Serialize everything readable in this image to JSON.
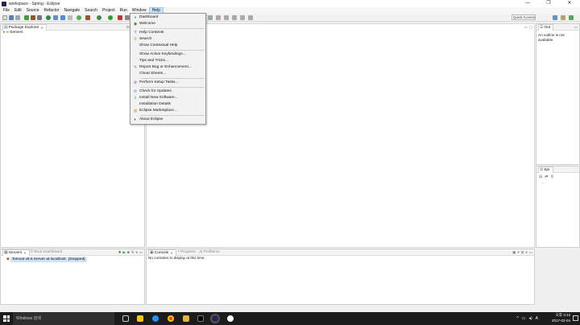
{
  "window": {
    "title": "workspace - Spring - Eclipse",
    "controls": [
      "—",
      "❐",
      "✕"
    ]
  },
  "menubar": [
    "File",
    "Edit",
    "Source",
    "Refactor",
    "Navigate",
    "Search",
    "Project",
    "Run",
    "Window",
    "Help"
  ],
  "quick_access": "Quick Access",
  "package_explorer": {
    "tab": "Package Explorer",
    "tree": [
      {
        "label": "Servers",
        "expand": "▸"
      }
    ]
  },
  "outline": {
    "tab": "Out",
    "message": "An outline is not available."
  },
  "spring": {
    "tab": "Spr"
  },
  "servers_view": {
    "tabs": [
      "Servers",
      "Boot Dashboard"
    ],
    "rows": [
      {
        "label": "Tomcat v8.5 Server at localhost",
        "status": "[Stopped]"
      }
    ]
  },
  "console_view": {
    "tabs": [
      "Console",
      "Progress",
      "Problems"
    ],
    "message": "No consoles to display at this time."
  },
  "help_menu": {
    "items": [
      {
        "label": "Dashboard",
        "icon": "dashboard-icon"
      },
      {
        "label": "Welcome",
        "icon": "welcome-icon"
      },
      {
        "label": "Help Contents",
        "icon": "help-contents-icon"
      },
      {
        "label": "Search",
        "icon": "search-icon"
      },
      {
        "label": "Show Contextual Help",
        "icon": ""
      },
      {
        "label": "Show Active Keybindings...",
        "icon": ""
      },
      {
        "label": "Tips and Tricks...",
        "icon": ""
      },
      {
        "label": "Report Bug or Enhancement...",
        "icon": "bug-icon"
      },
      {
        "label": "Cheat Sheets...",
        "icon": ""
      },
      {
        "label": "Perform Setup Tasks...",
        "icon": "setup-icon"
      },
      {
        "label": "Check for Updates",
        "icon": "update-icon"
      },
      {
        "label": "Install New Software...",
        "icon": "install-icon"
      },
      {
        "label": "Installation Details",
        "icon": ""
      },
      {
        "label": "Eclipse Marketplace...",
        "icon": "marketplace-icon"
      },
      {
        "label": "About Eclipse",
        "icon": "eclipse-icon"
      }
    ]
  },
  "taskbar": {
    "search_placeholder": "Windows 검색",
    "time": "오후 3:13",
    "date": "2017-02-04",
    "ime": "A"
  },
  "colors": {
    "accent": "#cce4f7",
    "taskbar": "#1c1c1c",
    "selection": "#cfe3f7"
  }
}
